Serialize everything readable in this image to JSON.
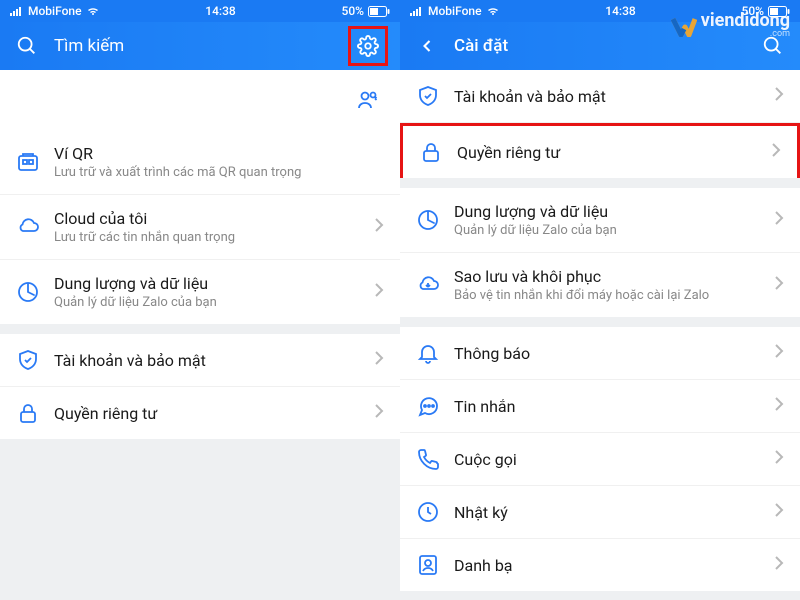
{
  "status": {
    "carrier": "MobiFone",
    "time": "14:38",
    "battery": "50%"
  },
  "left": {
    "search_placeholder": "Tìm kiếm",
    "items": [
      {
        "icon": "qr-wallet-icon",
        "title": "Ví QR",
        "sub": "Lưu trữ và xuất trình các mã QR quan trọng",
        "chevron": false
      },
      {
        "icon": "cloud-icon",
        "title": "Cloud của tôi",
        "sub": "Lưu trữ các tin nhắn quan trọng",
        "chevron": true
      },
      {
        "icon": "data-icon",
        "title": "Dung lượng và dữ liệu",
        "sub": "Quản lý dữ liệu Zalo của bạn",
        "chevron": true
      },
      {
        "icon": "shield-icon",
        "title": "Tài khoản và bảo mật",
        "sub": "",
        "chevron": true
      },
      {
        "icon": "lock-icon",
        "title": "Quyền riêng tư",
        "sub": "",
        "chevron": true
      }
    ]
  },
  "right": {
    "header_title": "Cài đặt",
    "items": [
      {
        "icon": "shield-icon",
        "title": "Tài khoản và bảo mật",
        "sub": "",
        "chevron": true,
        "highlight": false
      },
      {
        "icon": "lock-icon",
        "title": "Quyền riêng tư",
        "sub": "",
        "chevron": true,
        "highlight": true
      },
      {
        "icon": "data-icon",
        "title": "Dung lượng và dữ liệu",
        "sub": "Quản lý dữ liệu Zalo của bạn",
        "chevron": true,
        "highlight": false
      },
      {
        "icon": "cloud-restore-icon",
        "title": "Sao lưu và khôi phục",
        "sub": "Bảo vệ tin nhắn khi đổi máy hoặc cài lại Zalo",
        "chevron": true,
        "highlight": false
      },
      {
        "icon": "bell-icon",
        "title": "Thông báo",
        "sub": "",
        "chevron": true,
        "highlight": false
      },
      {
        "icon": "message-icon",
        "title": "Tin nhắn",
        "sub": "",
        "chevron": true,
        "highlight": false
      },
      {
        "icon": "call-icon",
        "title": "Cuộc gọi",
        "sub": "",
        "chevron": true,
        "highlight": false
      },
      {
        "icon": "diary-icon",
        "title": "Nhật ký",
        "sub": "",
        "chevron": true,
        "highlight": false
      },
      {
        "icon": "contacts-icon",
        "title": "Danh bạ",
        "sub": "",
        "chevron": true,
        "highlight": false
      }
    ]
  },
  "watermark": {
    "text": "viendidong",
    "sub": ".com"
  },
  "colors": {
    "primary": "#1a7af3",
    "highlight": "#e61414",
    "icon": "#2a7af5"
  }
}
